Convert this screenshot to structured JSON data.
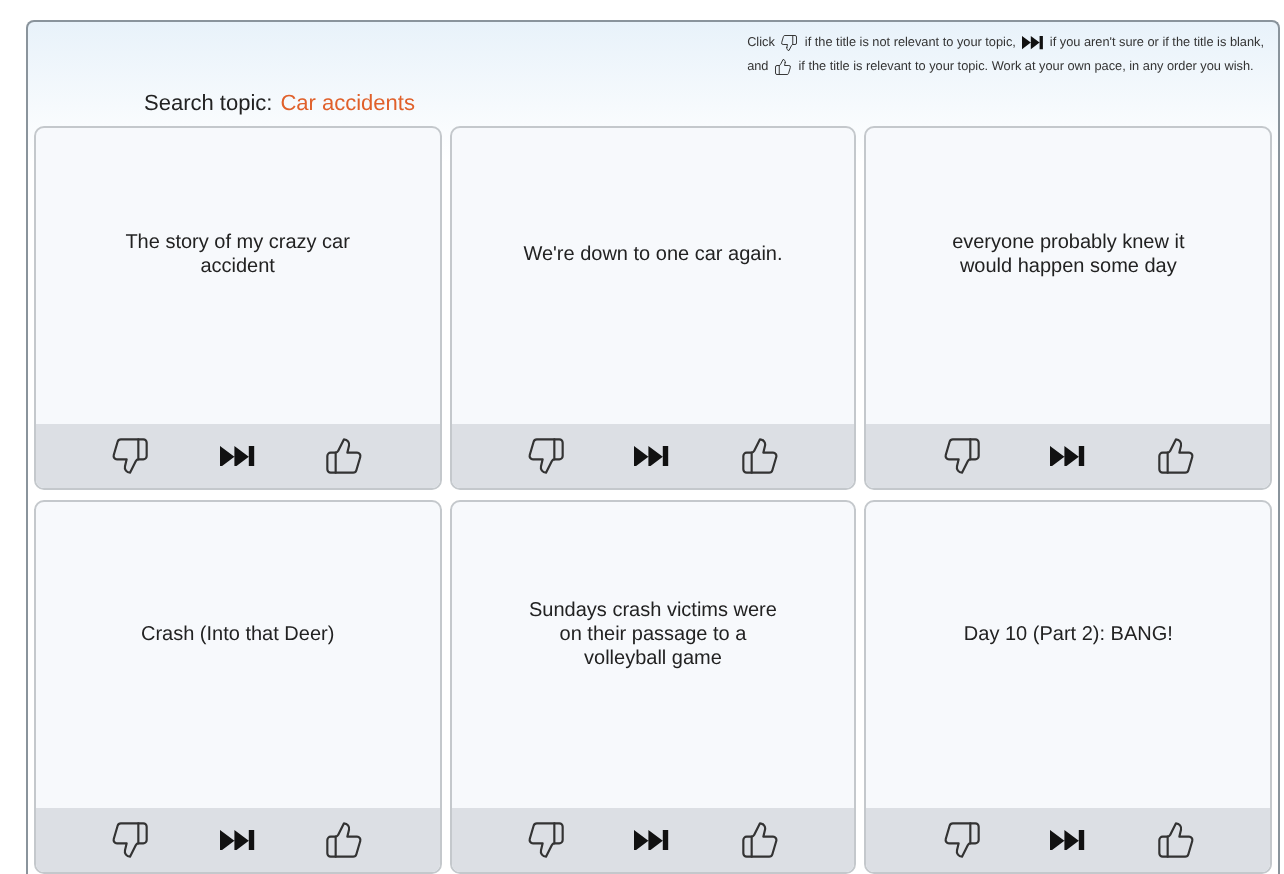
{
  "instructions": {
    "line_1": [
      {
        "kind": "text",
        "text": "Click"
      },
      {
        "kind": "dislike"
      },
      {
        "kind": "text",
        "text": "if the title is not relevant to your topic,"
      },
      {
        "kind": "skip"
      },
      {
        "kind": "text",
        "text": "if you aren't sure or if the title is blank,"
      }
    ],
    "line_2": [
      {
        "kind": "text",
        "text": "and"
      },
      {
        "kind": "like"
      },
      {
        "kind": "text",
        "text": "if the title is relevant to your topic. Work at your own pace, in any order you wish."
      }
    ]
  },
  "search_topic": {
    "label": "Search topic:",
    "value": "Car accidents"
  },
  "cards": [
    {
      "title": "The story of my crazy car accident"
    },
    {
      "title": "We're down to one car again."
    },
    {
      "title": "everyone probably knew it would happen some day"
    },
    {
      "title": "Crash (Into that Deer)"
    },
    {
      "title": "Sundays crash victims were on their passage to a volleyball game"
    },
    {
      "title": "Day 10 (Part 2): BANG!"
    }
  ]
}
